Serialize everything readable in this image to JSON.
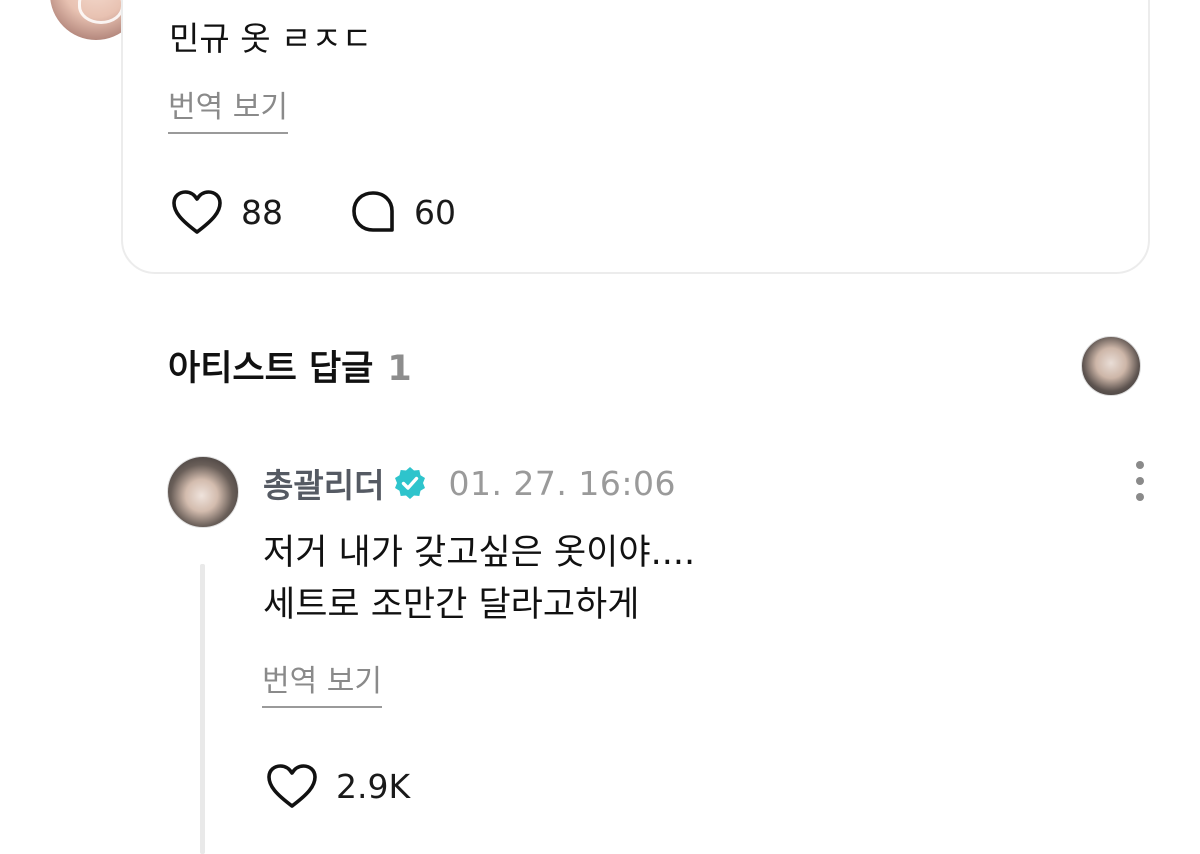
{
  "post": {
    "text": "민규 옷 ㄹㅈㄷ",
    "translate_label": "번역 보기",
    "likes": "88",
    "comments": "60",
    "like_icon": "heart-outline-icon",
    "comment_icon": "speech-bubble-icon"
  },
  "artist_replies": {
    "title": "아티스트 답글",
    "count": "1"
  },
  "reply": {
    "author": "총괄리더",
    "verified_icon": "verified-badge-icon",
    "verified_color": "#2ec4cc",
    "timestamp": "01. 27. 16:06",
    "lines": [
      "저거 내가 갖고싶은 옷이야....",
      "세트로 조만간 달라고하게"
    ],
    "translate_label": "번역 보기",
    "likes": "2.9K"
  }
}
